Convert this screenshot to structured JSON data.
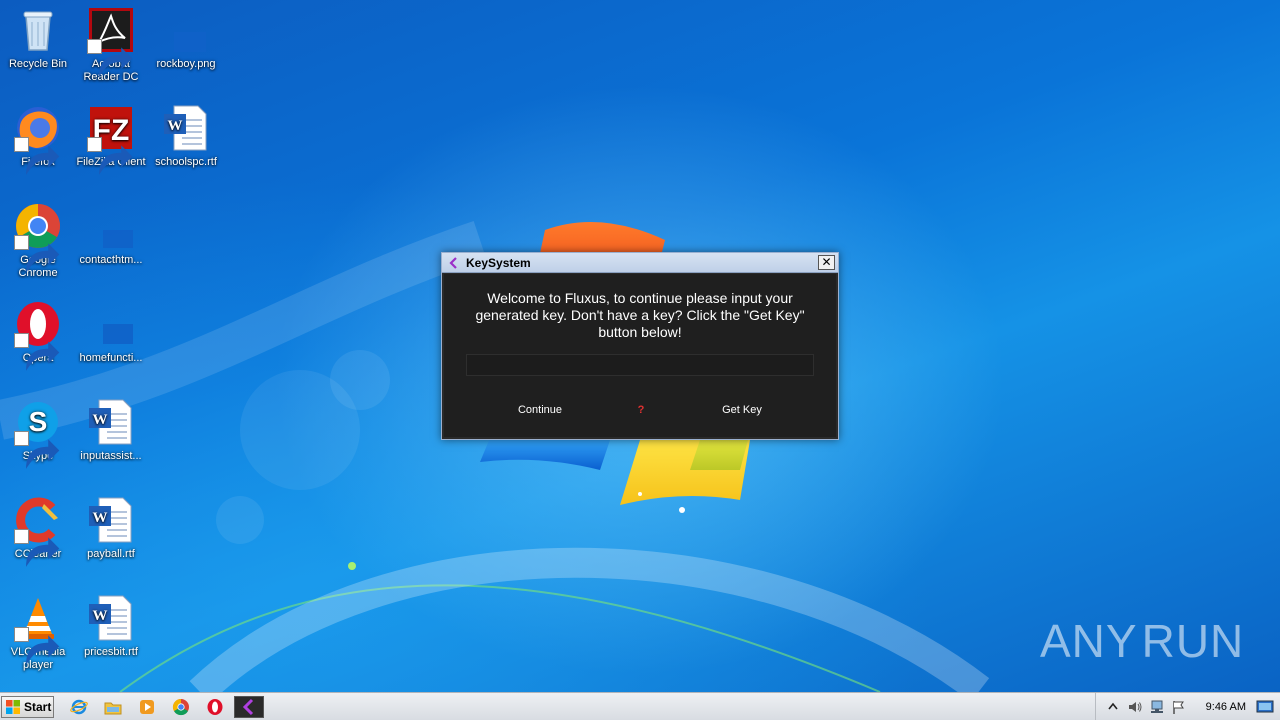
{
  "desktop": {
    "icons": [
      {
        "label": "Recycle Bin",
        "icon": "recycle-bin-icon"
      },
      {
        "label": "Acrobat Reader DC",
        "icon": "acrobat-icon"
      },
      {
        "label": "rockboy.png",
        "icon": "image-file-icon"
      },
      {
        "label": "Firefox",
        "icon": "firefox-icon"
      },
      {
        "label": "FileZilla Client",
        "icon": "filezilla-icon"
      },
      {
        "label": "schoolspc.rtf",
        "icon": "word-document-icon"
      },
      {
        "label": "Google Chrome",
        "icon": "chrome-icon"
      },
      {
        "label": "contacthtm...",
        "icon": "file-icon"
      },
      {
        "label": "Opera",
        "icon": "opera-icon"
      },
      {
        "label": "homefuncti...",
        "icon": "file-icon"
      },
      {
        "label": "Skype",
        "icon": "skype-icon"
      },
      {
        "label": "inputassist...",
        "icon": "word-document-icon"
      },
      {
        "label": "CCleaner",
        "icon": "ccleaner-icon"
      },
      {
        "label": "payball.rtf",
        "icon": "word-document-icon"
      },
      {
        "label": "VLC media player",
        "icon": "vlc-icon"
      },
      {
        "label": "pricesbit.rtf",
        "icon": "word-document-icon"
      }
    ],
    "watermark": {
      "left": "ANY",
      "right": "RUN"
    }
  },
  "dialog": {
    "title": "KeySystem",
    "close_label": "✕",
    "message": "Welcome to Fluxus, to continue please input your generated key. Don't have a key? Click the \"Get Key\" button below!",
    "key_input_value": "",
    "key_input_placeholder": "",
    "continue_label": "Continue",
    "help_label": "?",
    "getkey_label": "Get Key",
    "accent_color": "#e03030"
  },
  "taskbar": {
    "start_label": "Start",
    "pinned": [
      "internet-explorer-icon",
      "file-explorer-icon",
      "media-player-icon",
      "chrome-icon",
      "opera-icon",
      "fluxus-icon"
    ],
    "clock": "9:46 AM"
  }
}
